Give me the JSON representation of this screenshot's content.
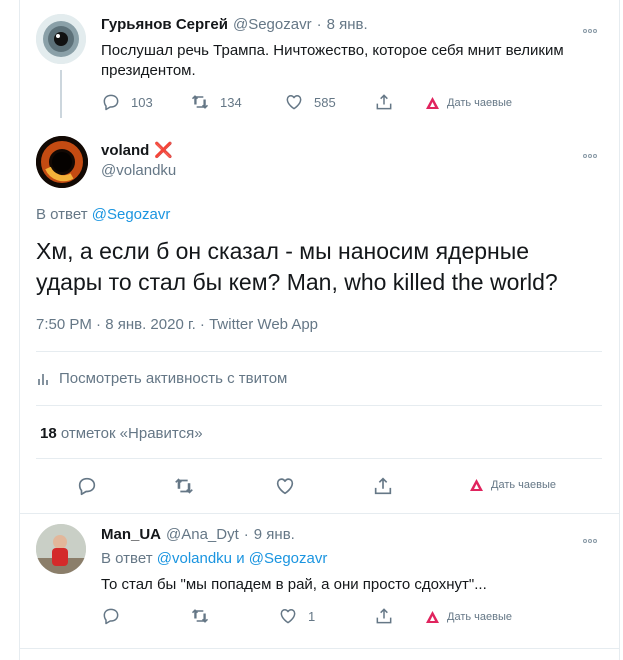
{
  "tweet1": {
    "name": "Гурьянов Сергей",
    "handle": "@Segozavr",
    "sep": "·",
    "date": "8 янв.",
    "text": "Послушал речь Трампа. Ничтожество, которое себя мнит великим президентом.",
    "reply_count": "103",
    "retweet_count": "134",
    "like_count": "585",
    "tip_label": "Дать чаевые"
  },
  "tweet2": {
    "name": "voland",
    "name_badge": "❌",
    "handle": "@volandku",
    "reply_prefix": "В ответ",
    "reply_to": "@Segozavr",
    "text": "Хм, а если б он сказал - мы наносим ядерные удары то стал бы кем? Man, who killed the world?",
    "timestamp": "7:50 PM · 8 янв. 2020 г. · Twitter Web App",
    "activity_label": "Посмотреть активность с твитом",
    "likes_count": "18",
    "likes_label": "отметок «Нравится»",
    "tip_label": "Дать чаевые"
  },
  "tweet3": {
    "name": "Man_UA",
    "handle": "@Ana_Dyt",
    "sep": "·",
    "date": "9 янв.",
    "reply_prefix": "В ответ",
    "reply_to_1": "@volandku",
    "reply_and": "и",
    "reply_to_2": "@Segozavr",
    "text": "То стал бы \"мы попадем в рай, а они просто сдохнут\"...",
    "like_count": "1",
    "tip_label": "Дать чаевые"
  },
  "colors": {
    "accent": "#1b95e0",
    "muted": "#657786",
    "tip_red": "#e0245e",
    "badge_red": "#e0245e"
  },
  "icons": [
    "reply-icon",
    "retweet-icon",
    "like-icon",
    "share-icon",
    "tip-icon",
    "more-icon",
    "activity-icon"
  ]
}
